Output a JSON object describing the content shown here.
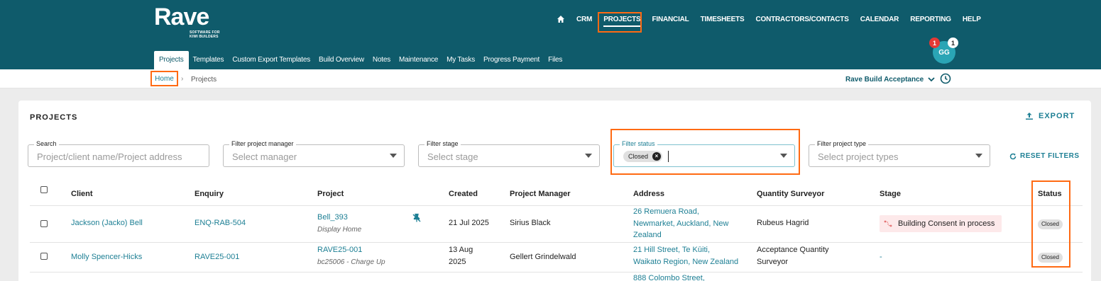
{
  "brand": {
    "name": "Rave",
    "tagline_line1": "SOFTWARE FOR",
    "tagline_line2": "KIWI BUILDERS",
    "color_primary": "#0f5b6b",
    "color_accent": "#1d7f94",
    "highlight_color": "#ff6a13"
  },
  "main_nav": [
    {
      "label": "CRM"
    },
    {
      "label": "PROJECTS",
      "active": true
    },
    {
      "label": "FINANCIAL"
    },
    {
      "label": "TIMESHEETS"
    },
    {
      "label": "CONTRACTORS/CONTACTS"
    },
    {
      "label": "CALENDAR"
    },
    {
      "label": "REPORTING"
    },
    {
      "label": "HELP"
    }
  ],
  "sub_nav": [
    {
      "label": "Projects",
      "active": true
    },
    {
      "label": "Templates"
    },
    {
      "label": "Custom Export Templates"
    },
    {
      "label": "Build Overview"
    },
    {
      "label": "Notes"
    },
    {
      "label": "Maintenance"
    },
    {
      "label": "My Tasks"
    },
    {
      "label": "Progress Payment"
    },
    {
      "label": "Files"
    }
  ],
  "user": {
    "initials": "GG",
    "notification_count": "1",
    "message_count": "1"
  },
  "breadcrumb": {
    "home": "Home",
    "separator": "›",
    "current": "Projects"
  },
  "company_selector": "Rave Build Acceptance",
  "page": {
    "title": "PROJECTS",
    "export_label": "EXPORT",
    "reset_label": "RESET FILTERS"
  },
  "filters": {
    "search": {
      "label": "Search",
      "placeholder": "Project/client name/Project address"
    },
    "manager": {
      "label": "Filter project manager",
      "placeholder": "Select manager"
    },
    "stage": {
      "label": "Filter stage",
      "placeholder": "Select stage"
    },
    "status": {
      "label": "Filter status",
      "chip": "Closed",
      "chip_remove": "×"
    },
    "type": {
      "label": "Filter project type",
      "placeholder": "Select project types"
    }
  },
  "table": {
    "headers": {
      "client": "Client",
      "enquiry": "Enquiry",
      "project": "Project",
      "created": "Created",
      "manager": "Project Manager",
      "address": "Address",
      "qs": "Quantity Surveyor",
      "stage": "Stage",
      "status": "Status"
    },
    "rows": [
      {
        "client": "Jackson (Jacko) Bell",
        "enquiry": "ENQ-RAB-504",
        "project_name": "Bell_393",
        "project_sub": "Display Home",
        "created": "21 Jul 2025",
        "manager": "Sirius Black",
        "address_l1": "26 Remuera Road,",
        "address_l2": "Newmarket, Auckland, New",
        "address_l3": "Zealand",
        "qs_l1": "Rubeus Hagrid",
        "qs_l2": "",
        "stage": "Building Consent in process",
        "status": "Closed"
      },
      {
        "client": "Molly Spencer-Hicks",
        "enquiry": "RAVE25-001",
        "project_name": "RAVE25-001",
        "project_sub": "bc25006 - Charge Up",
        "created_l1": "13 Aug",
        "created_l2": "2025",
        "manager": "Gellert Grindelwald",
        "address_l1": "21 Hill Street, Te Kūiti,",
        "address_l2": "Waikato Region, New Zealand",
        "qs_l1": "Acceptance Quantity",
        "qs_l2": "Surveyor",
        "stage": "-",
        "status": "Closed"
      },
      {
        "address_l1": "888 Colombo Street,"
      }
    ]
  }
}
